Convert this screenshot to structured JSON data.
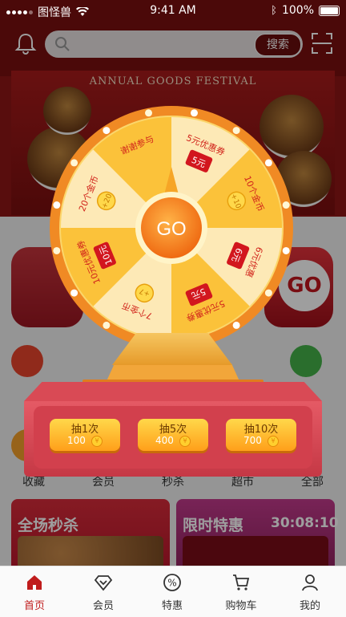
{
  "status": {
    "carrier": "图怪兽",
    "time": "9:41 AM",
    "battery": "100%"
  },
  "header": {
    "search_button": "搜索"
  },
  "banner": {
    "title": "ANNUAL GOODS FESTIVAL"
  },
  "promo": {
    "go": "GO"
  },
  "categories": [
    {
      "label": "收藏",
      "color": "#f4a12a"
    },
    {
      "label": "会员",
      "color": "#f4a12a"
    },
    {
      "label": "秒杀",
      "color": "#f4a12a"
    },
    {
      "label": "超市",
      "color": "#f4a12a"
    },
    {
      "label": "全部",
      "color": "#f4a12a"
    }
  ],
  "cards": {
    "flash_sale": "全场秒杀",
    "limited": "限时特惠",
    "countdown": "30:08:10"
  },
  "wheel": {
    "go": "GO",
    "segments": [
      {
        "text": "5元优惠券",
        "ticket": "5元"
      },
      {
        "text": "10个金币",
        "coin": "+10"
      },
      {
        "text": "6元优惠",
        "ticket": "6元"
      },
      {
        "text": "5元优惠券",
        "ticket": "5元"
      },
      {
        "text": "7个金币",
        "coin": "+7"
      },
      {
        "text": "10元优惠券",
        "ticket": "10元"
      },
      {
        "text": "20个金币",
        "coin": "+20"
      },
      {
        "text": "谢谢参与"
      }
    ]
  },
  "draw_buttons": [
    {
      "label": "抽1次",
      "cost": "100"
    },
    {
      "label": "抽5次",
      "cost": "400"
    },
    {
      "label": "抽10次",
      "cost": "700"
    }
  ],
  "tabs": [
    {
      "label": "首页",
      "icon": "home-icon",
      "active": true
    },
    {
      "label": "会员",
      "icon": "diamond-icon"
    },
    {
      "label": "特惠",
      "icon": "discount-icon"
    },
    {
      "label": "购物车",
      "icon": "cart-icon"
    },
    {
      "label": "我的",
      "icon": "user-icon"
    }
  ]
}
